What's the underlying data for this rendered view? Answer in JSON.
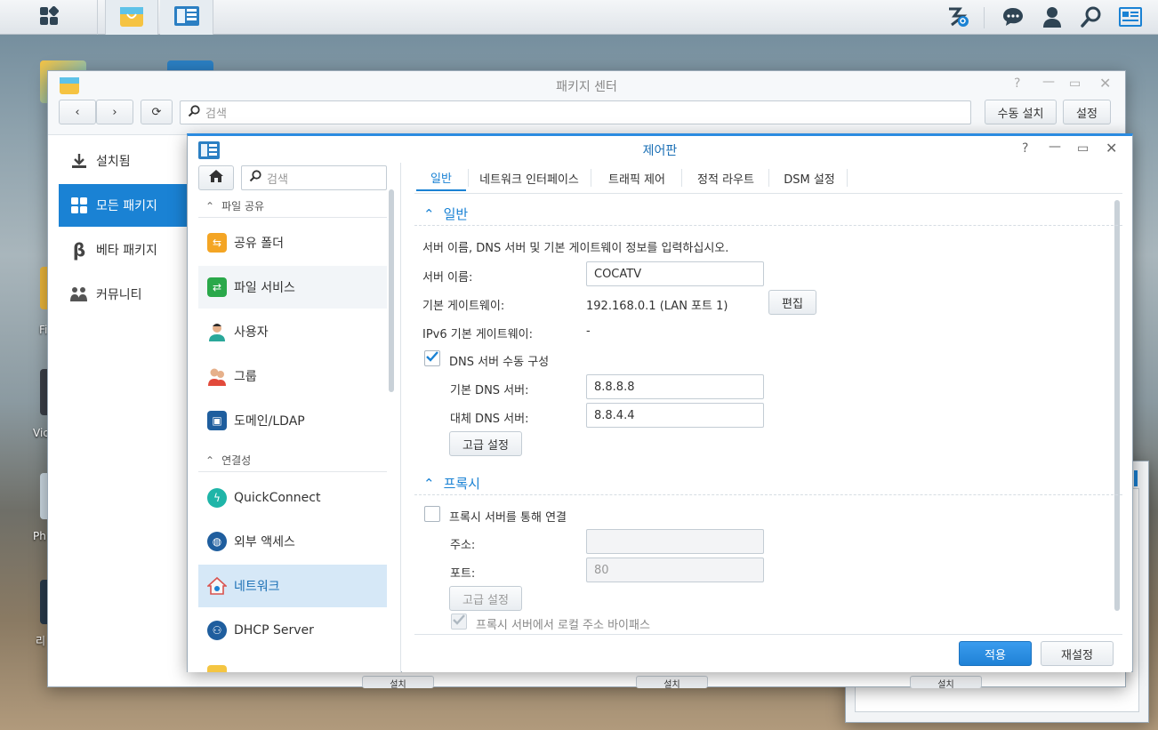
{
  "taskbar": {
    "icons": [
      "grid-icon",
      "package-center-icon",
      "control-panel-icon",
      "search-service-icon",
      "chat-icon",
      "user-icon",
      "search-icon",
      "widgets-icon"
    ]
  },
  "desktop": {
    "labels": [
      "Fi",
      "Vic",
      "Ph",
      "리"
    ]
  },
  "package_center": {
    "title": "패키지 센터",
    "search_placeholder": "검색",
    "manual_install": "수동 설치",
    "settings": "설정",
    "nav": [
      {
        "label": "설치됨",
        "icon": "download-icon"
      },
      {
        "label": "모든 패키지",
        "icon": "apps-icon"
      },
      {
        "label": "베타 패키지",
        "icon": "beta-icon"
      },
      {
        "label": "커뮤니티",
        "icon": "community-icon"
      }
    ],
    "bottom_buttons": [
      "설치",
      "설치",
      "설치"
    ]
  },
  "control_panel": {
    "title": "제어판",
    "search_placeholder": "검색",
    "sections": {
      "file_sharing": "파일 공유",
      "connectivity": "연결성"
    },
    "items": {
      "shared_folder": "공유 폴더",
      "file_services": "파일 서비스",
      "user": "사용자",
      "group": "그룹",
      "domain_ldap": "도메인/LDAP",
      "quickconnect": "QuickConnect",
      "external_access": "외부 액세스",
      "network": "네트워크",
      "dhcp_server": "DHCP Server"
    },
    "tabs": [
      "일반",
      "네트워크 인터페이스",
      "트래픽 제어",
      "정적 라우트",
      "DSM 설정"
    ],
    "general": {
      "header": "일반",
      "description": "서버 이름, DNS 서버 및 기본 게이트웨이 정보를 입력하십시오.",
      "server_name_label": "서버 이름:",
      "server_name": "COCATV",
      "gateway_label": "기본 게이트웨이:",
      "gateway": "192.168.0.1 (LAN 포트 1)",
      "edit": "편집",
      "ipv6_label": "IPv6 기본 게이트웨이:",
      "ipv6": "-",
      "dns_manual_label": "DNS 서버 수동 구성",
      "dns_manual": true,
      "primary_dns_label": "기본 DNS 서버:",
      "primary_dns": "8.8.8.8",
      "secondary_dns_label": "대체 DNS 서버:",
      "secondary_dns": "8.8.4.4",
      "advanced": "고급 설정"
    },
    "proxy": {
      "header": "프록시",
      "connect_label": "프록시 서버를 통해 연결",
      "connect": false,
      "address_label": "주소:",
      "address": "",
      "port_label": "포트:",
      "port": "80",
      "advanced": "고급 설정",
      "bypass_label": "프록시 서버에서 로컬 주소 바이패스",
      "bypass": true
    },
    "apply": "적용",
    "reset": "재설정"
  },
  "colors": {
    "accent": "#1a82d4",
    "selected_nav": "#1a82d4",
    "selected_item_bg": "#d6e8f7",
    "apply_button": "#2a8ee0"
  }
}
